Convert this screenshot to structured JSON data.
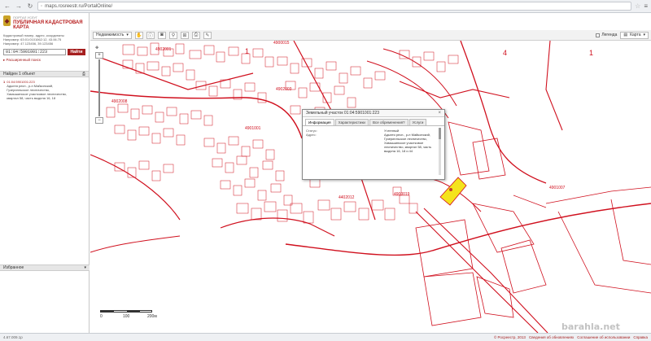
{
  "browser": {
    "url": "maps.rosreestr.ru/PortalOnline/"
  },
  "sidebar": {
    "logo_small": "ПОРТАЛ УСЛУГ",
    "logo_title": "ПУБЛИЧНАЯ КАДАСТРОВАЯ КАРТА",
    "coords_line1": "Кадастровый номер, адрес, координаты",
    "coords_line2": "Например: 63:01:0101062:12, 43.06.75",
    "coords_line3": "Например: 47.123456, 39.123456",
    "search_value": "01:04:5901001:223",
    "search_button": "Найти",
    "advanced_link": "▸ Расширенный поиск",
    "results_header": "Найден 1 объект",
    "result_number": "1",
    "result_title": "01:04:5901001:223",
    "result_line1": "Адыгея респ., р-н Майкопский,",
    "result_line2": "Гузерипльское лесничество,",
    "result_line3": "Хамышинское участковое лесничество,",
    "result_line4": "квартал 58, часть выдела 16, 18",
    "favorites": "Избранное"
  },
  "toolbar": {
    "mode_select": "Недвижимость",
    "legend_label": "Легенда",
    "basemap_select": "Карта"
  },
  "map": {
    "labels": [
      {
        "text": "4",
        "kind": "big"
      },
      {
        "text": "1",
        "kind": "big"
      },
      {
        "text": "1",
        "kind": "big"
      },
      {
        "text": "4902008",
        "kind": "quarter"
      },
      {
        "text": "4900015",
        "kind": "quarter"
      },
      {
        "text": "4902001",
        "kind": "quarter"
      },
      {
        "text": "4902003",
        "kind": "quarter"
      },
      {
        "text": "4901001",
        "kind": "quarter"
      },
      {
        "text": "4901007",
        "kind": "quarter"
      },
      {
        "text": "4900019",
        "kind": "quarter"
      },
      {
        "text": "4402012",
        "kind": "quarter"
      }
    ],
    "scale_labels": [
      "0",
      "100",
      "200м"
    ]
  },
  "popup": {
    "title": "Земельный участок 01:04:5901001:223",
    "tabs": [
      "Информация",
      "Характеристики",
      "Все обременения?",
      "Услуги"
    ],
    "field_status_label": "Статус:",
    "field_address_label": "Адрес:",
    "status_value": "Учтенный",
    "address_value": "Адыгея респ., р-н Майкопский, Гузерипльское лесничество, Хамышинское участковое лесничество, квартал 58, часть выдела 16, 18 и 44"
  },
  "status": {
    "left": "4.67.009.1p",
    "right1": "© Росреестр, 2013",
    "right2": "Сведения об обновлениях",
    "right3": "Соглашение об использовании",
    "right4": "Справка"
  },
  "watermark": "barahla.net",
  "colors": {
    "brand": "#a51e1e",
    "parcel_line": "#d0101e",
    "selected_parcel": "#f4e31c"
  }
}
